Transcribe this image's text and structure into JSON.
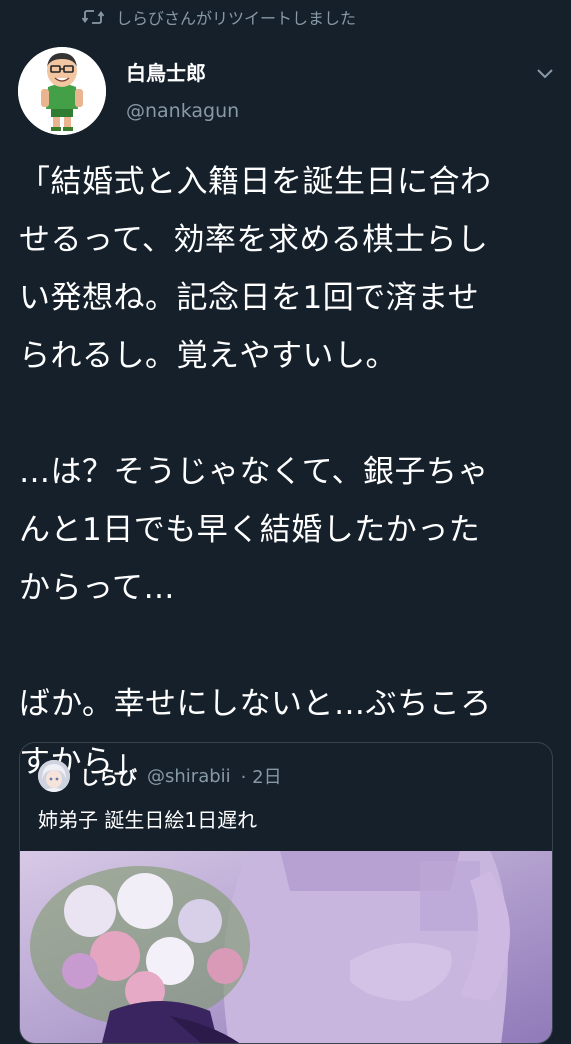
{
  "retweet": {
    "icon": "retweet-icon",
    "text": "しらびさんがリツイートしました"
  },
  "author": {
    "name": "白鳥士郎",
    "handle": "@nankagun",
    "avatar_icon": "avatar-cartoon-man"
  },
  "menu": {
    "icon": "chevron-down-icon"
  },
  "tweet": {
    "lines": [
      "「結婚式と入籍日を誕生日に合わ",
      "せるって、効率を求める棋士らし",
      "い発想ね。記念日を1回で済ませ",
      "られるし。覚えやすいし。",
      "",
      "…は？そうじゃなくて、銀子ちゃ",
      "んと1日でも早く結婚したかった",
      "からって…",
      "",
      "ばか。幸せにしないと…ぶちころ",
      "すから」"
    ]
  },
  "quote": {
    "name": "しらび",
    "handle": "@shirabii",
    "time": "· 2日",
    "text": "姉弟子 誕生日絵1日遅れ",
    "image": "wedding-bouquet-illustration"
  },
  "colors": {
    "background": "#15202b",
    "secondary_text": "#8899a6",
    "border": "#38444d",
    "primary_text": "#ffffff"
  }
}
